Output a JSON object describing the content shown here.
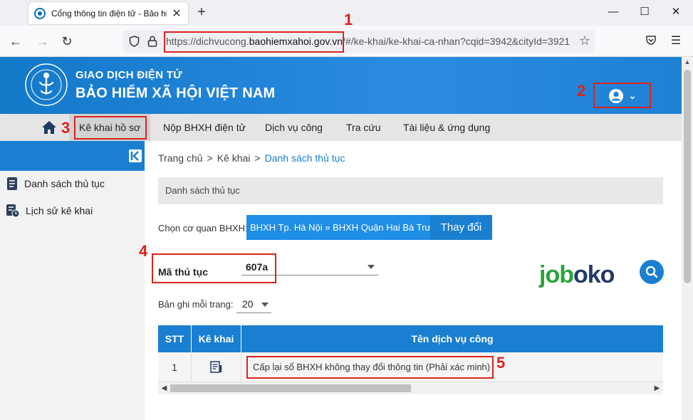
{
  "browser": {
    "tab_title": "Cổng thông tin điện tử - Bảo hiểm",
    "url_prefix": "https://dichvucong.",
    "url_domain": "baohiemxahoi.gov.vn",
    "url_rest": "/#/ke-khai/ke-khai-ca-nhan?cqid=3942&cityId=3921",
    "close_tab": "✕",
    "new_tab": "+"
  },
  "header": {
    "line1": "GIAO DỊCH ĐIỆN TỬ",
    "line2": "BẢO HIỂM XÃ HỘI VIỆT NAM",
    "logo_ring_text": "BẢO HIỂM XÃ HỘI VIỆT NAM"
  },
  "menu": {
    "items": [
      {
        "label": "Kê khai hồ sơ"
      },
      {
        "label": "Nộp BHXH điện tử"
      },
      {
        "label": "Dịch vụ công"
      },
      {
        "label": "Tra cứu"
      },
      {
        "label": "Tài liệu & ứng dụng"
      }
    ]
  },
  "sidebar": {
    "items": [
      {
        "label": "Danh sách thủ tục"
      },
      {
        "label": "Lịch sử kê khai"
      }
    ]
  },
  "breadcrumb": {
    "home": "Trang chủ",
    "middle": "Kê khai",
    "current": "Danh sách thủ tục",
    "separator": ">"
  },
  "section_title": "Danh sách thủ tục",
  "agency": {
    "label": "Chọn cơ quan BHXH:",
    "value": "BHXH Tp. Hà Nội » BHXH Quận Hai Bà Trưng",
    "change_button": "Thay đổi"
  },
  "procedure_code": {
    "label": "Mã thủ tục",
    "value": "607a"
  },
  "brand_watermark": {
    "part1": "job",
    "part2": "oko"
  },
  "per_page": {
    "label": "Bản ghi mỗi trang:",
    "value": "20"
  },
  "table": {
    "headers": [
      "STT",
      "Kê khai",
      "Tên dịch vụ công"
    ],
    "rows": [
      {
        "stt": "1",
        "service": "Cấp lại sổ BHXH không thay đổi thông tin (Phải xác minh)"
      }
    ]
  },
  "annotations": [
    "1",
    "2",
    "3",
    "4",
    "5"
  ],
  "colors": {
    "primary": "#1a7fd0",
    "annotation": "#d9231d"
  }
}
